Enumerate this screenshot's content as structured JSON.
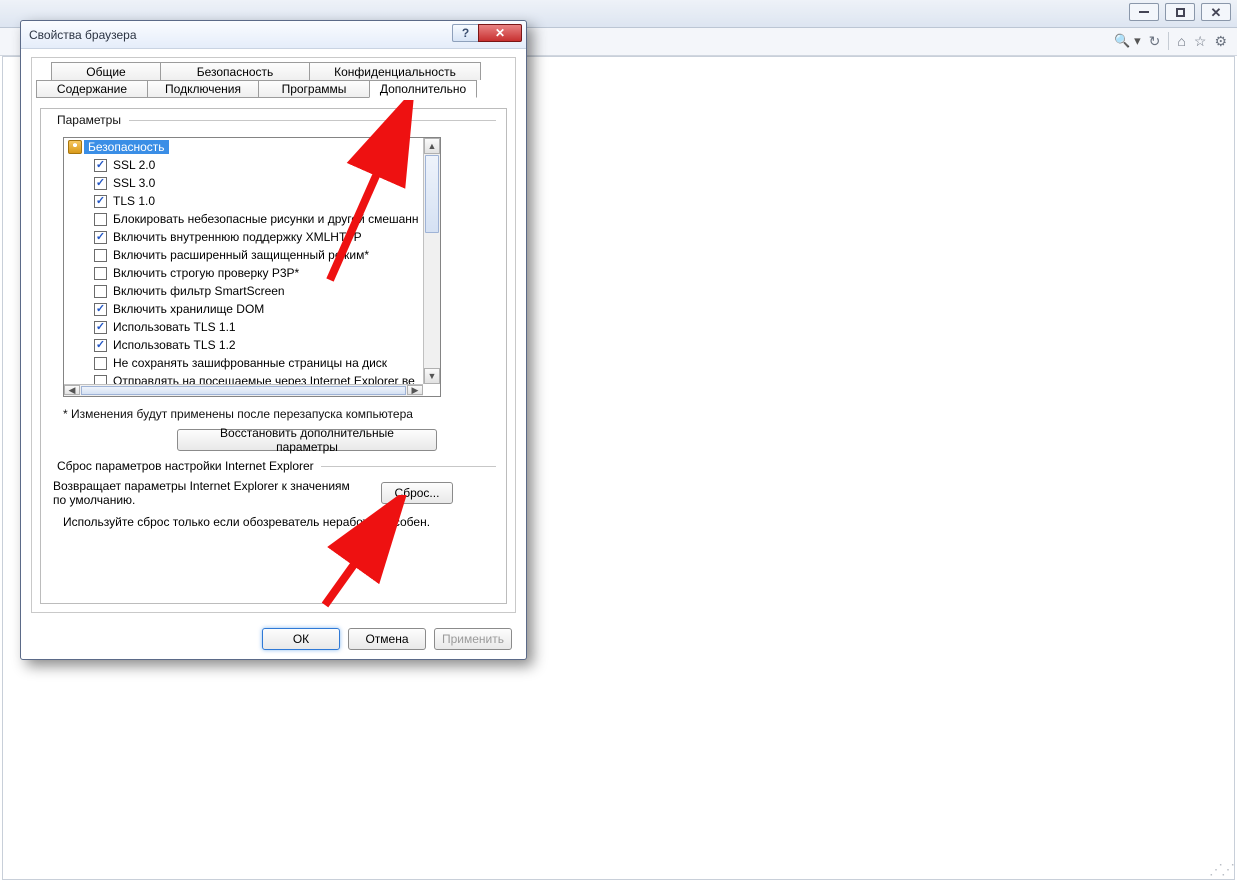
{
  "mainWindow": {
    "minimize": "min",
    "maximize": "max",
    "close": "close"
  },
  "toolbar": {
    "searchIcon": "search",
    "refreshIcon": "refresh",
    "homeIcon": "home",
    "starIcon": "favorites",
    "gearIcon": "settings"
  },
  "dialog": {
    "title": "Свойства браузера",
    "help": "?",
    "close": "X",
    "tabsRow1": [
      {
        "label": "Общие"
      },
      {
        "label": "Безопасность"
      },
      {
        "label": "Конфиденциальность"
      }
    ],
    "tabsRow2": [
      {
        "label": "Содержание"
      },
      {
        "label": "Подключения"
      },
      {
        "label": "Программы"
      },
      {
        "label": "Дополнительно"
      }
    ],
    "groupLabel": "Параметры",
    "securityHeader": "Безопасность",
    "items": [
      {
        "label": "SSL 2.0",
        "checked": true
      },
      {
        "label": "SSL 3.0",
        "checked": true
      },
      {
        "label": "TLS 1.0",
        "checked": true
      },
      {
        "label": "Блокировать небезопасные рисунки и другой смешанн",
        "checked": false
      },
      {
        "label": "Включить внутреннюю поддержку XMLHTTP",
        "checked": true
      },
      {
        "label": "Включить расширенный защищенный режим*",
        "checked": false
      },
      {
        "label": "Включить строгую проверку P3P*",
        "checked": false
      },
      {
        "label": "Включить фильтр SmartScreen",
        "checked": false
      },
      {
        "label": "Включить хранилище DOM",
        "checked": true
      },
      {
        "label": "Использовать TLS 1.1",
        "checked": true
      },
      {
        "label": "Использовать TLS 1.2",
        "checked": true
      },
      {
        "label": "Не сохранять зашифрованные страницы на диск",
        "checked": false
      },
      {
        "label": "Отправлять на посещаемые через Internet Explorer ве",
        "checked": false
      }
    ],
    "note": "* Изменения будут применены после перезапуска компьютера",
    "restoreBtn": "Восстановить дополнительные параметры",
    "group2Label": "Сброс параметров настройки Internet Explorer",
    "resetText": "Возвращает параметры Internet Explorer к значениям по умолчанию.",
    "resetBtn": "Сброс...",
    "resetNote": "Используйте сброс только если обозреватель неработоспособен.",
    "ok": "ОК",
    "cancel": "Отмена",
    "apply": "Применить"
  }
}
